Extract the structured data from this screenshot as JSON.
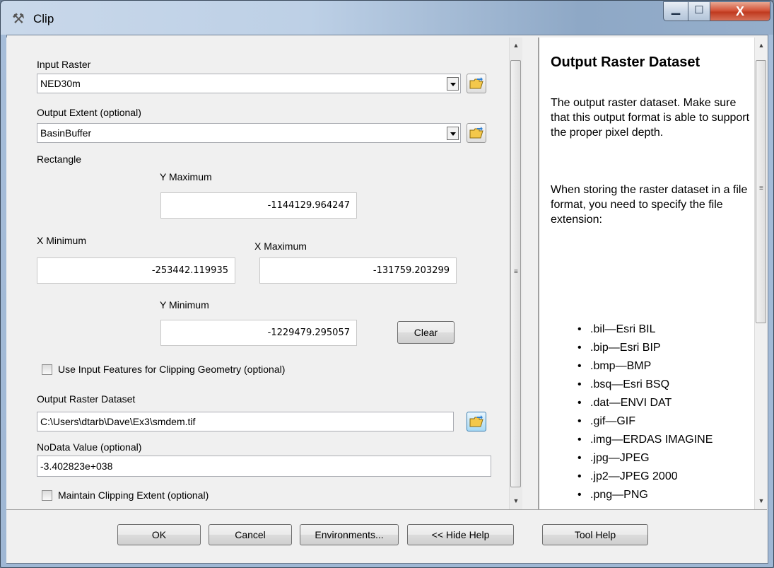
{
  "window": {
    "title": "Clip",
    "controls": {
      "minimize": "▁",
      "maximize": "☐",
      "close": "X"
    }
  },
  "form": {
    "input_raster": {
      "label": "Input Raster",
      "value": "NED30m"
    },
    "output_extent": {
      "label": "Output Extent (optional)",
      "value": "BasinBuffer"
    },
    "rectangle": {
      "label": "Rectangle",
      "y_max": {
        "label": "Y Maximum",
        "value": "-1144129.964247"
      },
      "x_min": {
        "label": "X Minimum",
        "value": "-253442.119935"
      },
      "x_max": {
        "label": "X Maximum",
        "value": "-131759.203299"
      },
      "y_min": {
        "label": "Y Minimum",
        "value": "-1229479.295057"
      },
      "clear_label": "Clear"
    },
    "use_input_features": {
      "label": "Use Input Features for Clipping Geometry (optional)",
      "checked": false
    },
    "output_raster": {
      "label": "Output Raster Dataset",
      "value": "C:\\Users\\dtarb\\Dave\\Ex3\\smdem.tif"
    },
    "nodata": {
      "label": "NoData Value (optional)",
      "value": "-3.402823e+038"
    },
    "maintain_extent": {
      "label": "Maintain Clipping Extent (optional)",
      "checked": false
    }
  },
  "help": {
    "title": "Output Raster Dataset",
    "para1": "The output raster dataset. Make sure that this output format is able to support the proper pixel depth.",
    "para2": "When storing the raster dataset in a file format, you need to specify the file extension:",
    "extensions": [
      ".bil—Esri BIL",
      ".bip—Esri BIP",
      ".bmp—BMP",
      ".bsq—Esri BSQ",
      ".dat—ENVI DAT",
      ".gif—GIF",
      ".img—ERDAS IMAGINE",
      ".jpg—JPEG",
      ".jp2—JPEG 2000",
      ".png—PNG"
    ]
  },
  "buttons": {
    "ok": "OK",
    "cancel": "Cancel",
    "environments": "Environments...",
    "hide_help": "<< Hide Help",
    "tool_help": "Tool Help"
  },
  "scroll_glyphs": {
    "up": "▲",
    "down": "▼",
    "grip": "≡"
  }
}
